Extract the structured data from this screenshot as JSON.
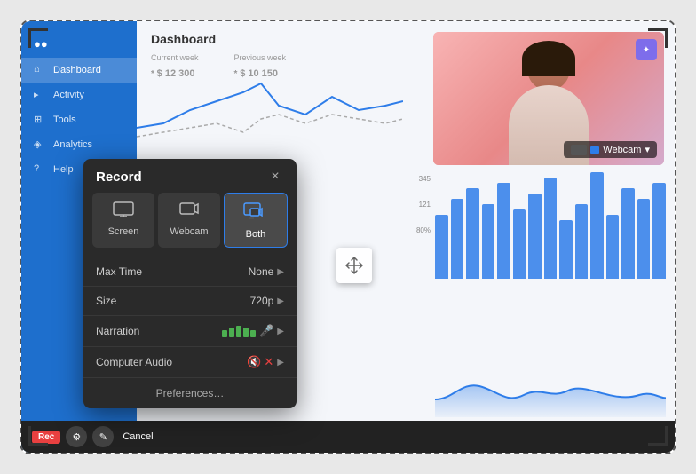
{
  "app": {
    "title": "Dashboard"
  },
  "sidebar": {
    "items": [
      {
        "label": "Dashboard",
        "icon": "⊞",
        "active": true
      },
      {
        "label": "Activity",
        "icon": "◈",
        "active": false
      },
      {
        "label": "Tools",
        "icon": "⊞",
        "active": false
      },
      {
        "label": "Analytics",
        "icon": "◈",
        "active": false
      },
      {
        "label": "Help",
        "icon": "?",
        "active": false
      }
    ]
  },
  "stats": {
    "current_week_label": "Current week",
    "current_week_value": "$ 12 300",
    "previous_week_label": "Previous week",
    "previous_week_value": "$ 10 150"
  },
  "grid_labels": {
    "v1": "345",
    "v2": "121",
    "v3": "80%"
  },
  "webcam": {
    "label": "Webcam",
    "edit_icon": "✦"
  },
  "record_panel": {
    "title": "Record",
    "close_label": "×",
    "modes": [
      {
        "label": "Screen",
        "icon": "🖥",
        "active": false
      },
      {
        "label": "Webcam",
        "icon": "📷",
        "active": false
      },
      {
        "label": "Both",
        "icon": "⊞",
        "active": true
      }
    ],
    "options": [
      {
        "label": "Max Time",
        "value": "None"
      },
      {
        "label": "Size",
        "value": "720p"
      }
    ],
    "narration_label": "Narration",
    "computer_audio_label": "Computer Audio",
    "preferences_label": "Preferences…"
  },
  "toolbar": {
    "rec_label": "Rec",
    "cancel_label": "Cancel"
  }
}
